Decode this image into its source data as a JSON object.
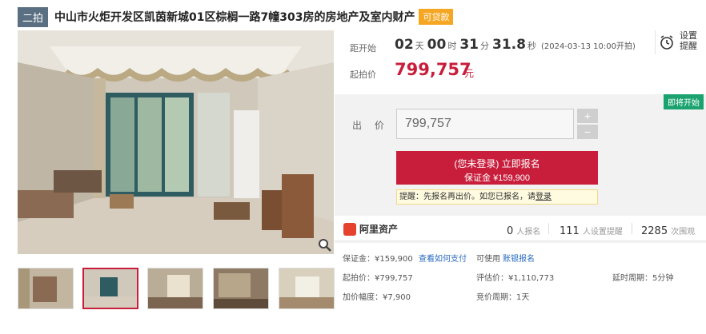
{
  "title": {
    "round": "二拍",
    "text": "中山市火炬开发区凯茵新城01区棕榈一路7幢303房的房地产及室内财产",
    "loan_badge": "可贷款"
  },
  "countdown": {
    "label": "距开始",
    "days": "02",
    "days_unit": "天",
    "hours": "00",
    "hours_unit": "时",
    "minutes": "31",
    "minutes_unit": "分",
    "seconds": "31.8",
    "seconds_unit": "秒",
    "start_time": "(2024-03-13 10:00开拍)"
  },
  "remind": {
    "label": "设置提醒",
    "icon": "alarm-clock-icon"
  },
  "start_price": {
    "label": "起拍价",
    "value": "799,757",
    "unit": "元"
  },
  "bid": {
    "status_badge": "即将开始",
    "label": "出 价",
    "input_value": "799,757",
    "plus": "+",
    "minus": "−",
    "signup_main": "(您未登录) 立即报名",
    "signup_sub": "保证金 ¥159,900",
    "notice_prefix": "提醒：先报名再出价。如您已报名，请",
    "notice_link": "登录"
  },
  "stats": {
    "platform": "阿里资产",
    "signups_num": "0",
    "signups_label": "人报名",
    "reminders_num": "111",
    "reminders_label": "人设置提醒",
    "views_num": "2285",
    "views_label": "次围观"
  },
  "details": {
    "deposit": "保证金：¥159,900",
    "deposit_link": "查看如何支付",
    "payment_prefix": "可使用",
    "payment_link": "账银报名",
    "starting_price": "起拍价：¥799,757",
    "appraisal": "评估价：¥1,110,773",
    "extension": "延时周期：5分钟",
    "increment": "加价幅度：¥7,900",
    "bidding_period": "竞价周期：1天"
  },
  "colors": {
    "accent_red": "#c81e3c",
    "badge_green": "#1aa36f",
    "badge_orange": "#f5a623",
    "round_badge": "#5a6f82"
  }
}
